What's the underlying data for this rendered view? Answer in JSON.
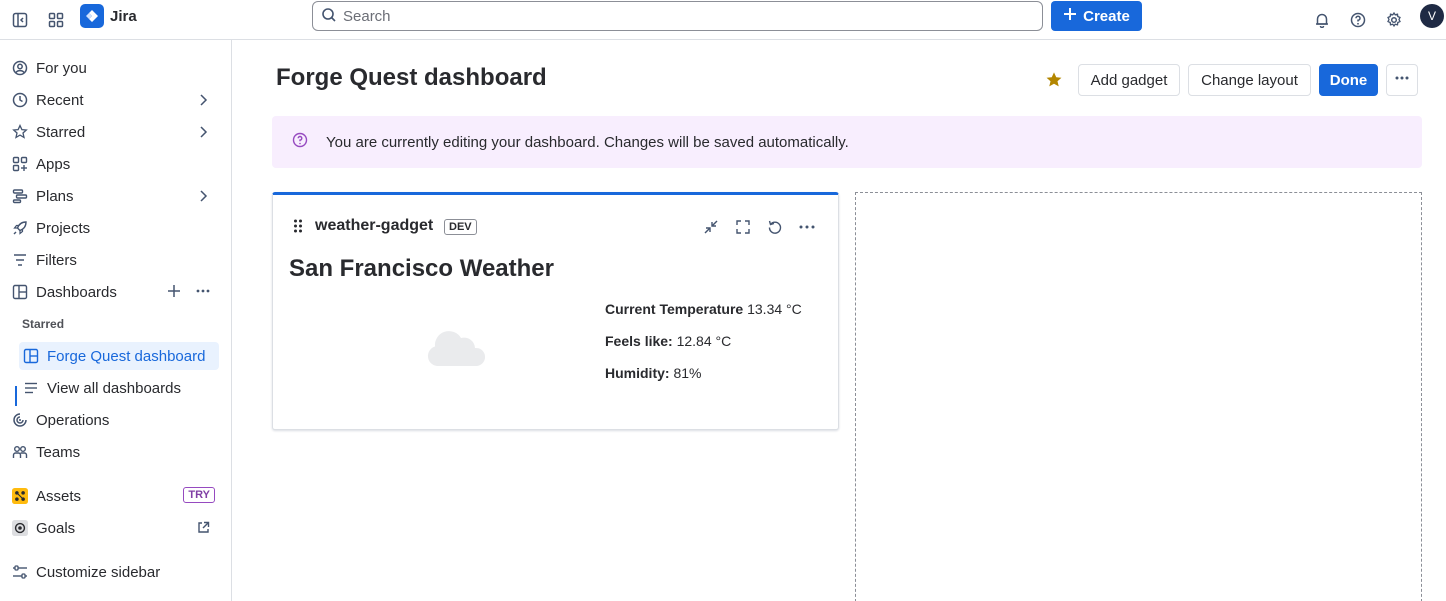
{
  "topbar": {
    "app_name": "Jira",
    "search_placeholder": "Search",
    "create_label": "Create",
    "avatar_initial": "V"
  },
  "sidebar": {
    "items": [
      {
        "label": "For you"
      },
      {
        "label": "Recent"
      },
      {
        "label": "Starred"
      },
      {
        "label": "Apps"
      },
      {
        "label": "Plans"
      },
      {
        "label": "Projects"
      },
      {
        "label": "Filters"
      },
      {
        "label": "Dashboards"
      }
    ],
    "starred_heading": "Starred",
    "starred_dashboard": "Forge Quest dashboard",
    "view_all": "View all dashboards",
    "operations": "Operations",
    "teams": "Teams",
    "assets": "Assets",
    "assets_badge": "TRY",
    "goals": "Goals",
    "customize": "Customize sidebar"
  },
  "main": {
    "title": "Forge Quest dashboard",
    "add_gadget": "Add gadget",
    "change_layout": "Change layout",
    "done": "Done",
    "banner": "You are currently editing your dashboard. Changes will be saved automatically."
  },
  "gadget": {
    "name": "weather-gadget",
    "badge": "DEV",
    "heading": "San Francisco Weather",
    "temp_label": "Current Temperature",
    "temp_value": "13.34 °C",
    "feels_label": "Feels like:",
    "feels_value": "12.84 °C",
    "humidity_label": "Humidity:",
    "humidity_value": "81%"
  },
  "colors": {
    "brand": "#1868db",
    "banner_bg": "#f8eefe",
    "star": "#b38600"
  }
}
